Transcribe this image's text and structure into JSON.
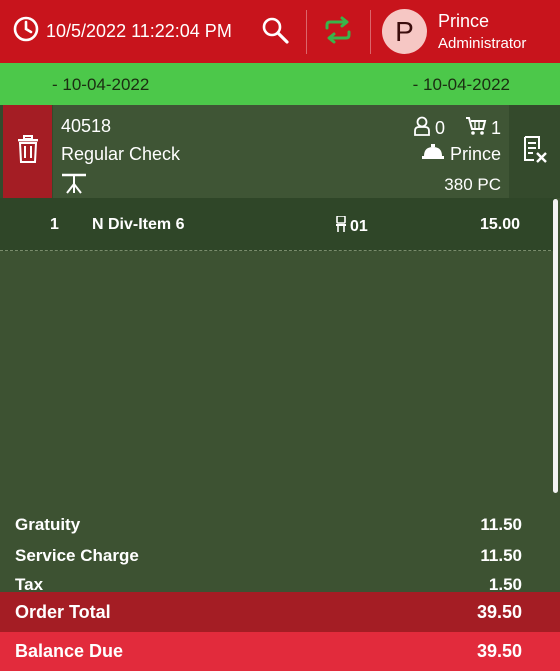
{
  "header": {
    "datetime": "10/5/2022 11:22:04 PM",
    "user_initial": "P",
    "user_name": "Prince",
    "user_role": "Administrator"
  },
  "date_range": {
    "left": "- 10-04-2022",
    "right": "- 10-04-2022"
  },
  "check": {
    "number": "40518",
    "type": "Regular Check",
    "guests": "0",
    "items_count": "1",
    "server": "Prince",
    "terminal": "380 PC"
  },
  "items": [
    {
      "qty": "1",
      "name": "N Div-Item 6",
      "seat": "01",
      "price": "15.00"
    }
  ],
  "totals": {
    "gratuity_label": "Gratuity",
    "gratuity": "11.50",
    "service_charge_label": "Service Charge",
    "service_charge": "11.50",
    "tax_label": "Tax",
    "tax": "1.50",
    "order_total_label": "Order Total",
    "order_total": "39.50",
    "balance_due_label": "Balance Due",
    "balance_due": "39.50"
  },
  "colors": {
    "header_red": "#c8141c",
    "date_green": "#4cc84a",
    "panel_green": "#3d5232",
    "order_total_red": "#a41d24",
    "balance_due_red": "#e22b3c",
    "sync_green": "#39b54a"
  },
  "icons": [
    "clock-icon",
    "search-icon",
    "sync-icon",
    "trash-icon",
    "table-icon",
    "guest-icon",
    "cart-icon",
    "server-icon",
    "void-check-icon",
    "seat-icon"
  ]
}
